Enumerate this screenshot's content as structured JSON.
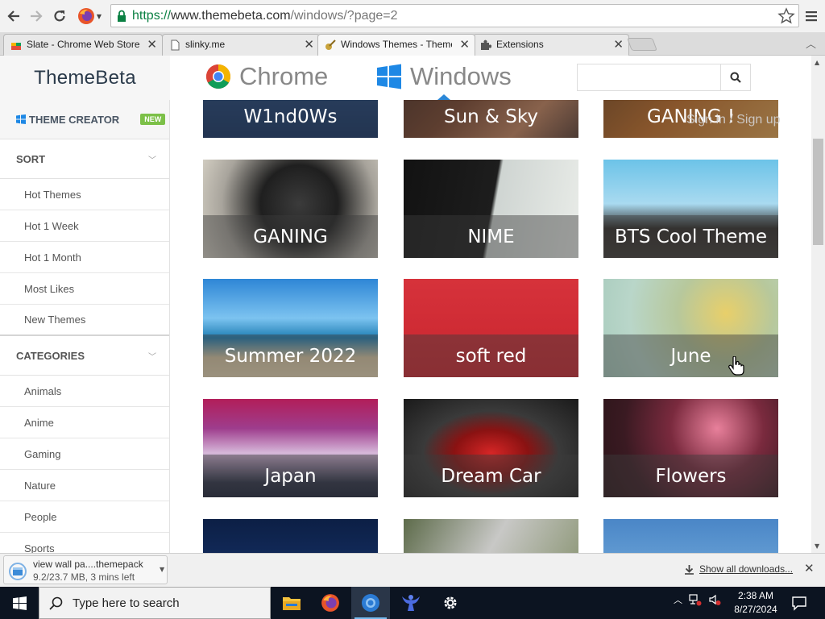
{
  "browser": {
    "url": {
      "scheme": "https://",
      "host": "www.themebeta.com",
      "path": "/windows/?page=2"
    },
    "tabs": [
      {
        "title": "Slate - Chrome Web Store",
        "active": false
      },
      {
        "title": "slinky.me",
        "active": false
      },
      {
        "title": "Windows Themes - Theme",
        "active": true
      },
      {
        "title": "Extensions",
        "active": false
      }
    ],
    "close_glyph": "✕",
    "accent_green": "#0b8043"
  },
  "site": {
    "logo": "ThemeBeta",
    "nav": [
      {
        "label": "Chrome",
        "icon": "chrome-icon"
      },
      {
        "label": "Windows",
        "icon": "windows-logo-icon"
      }
    ],
    "search_placeholder": "",
    "signin_text": "Sign in / Sign up",
    "brand_blue": "#2b88d8"
  },
  "sidebar": {
    "theme_creator": {
      "label": "THEME CREATOR",
      "badge": "NEW"
    },
    "sort": {
      "heading": "SORT",
      "items": [
        "Hot Themes",
        "Hot 1 Week",
        "Hot 1 Month",
        "Most Likes",
        "New Themes"
      ]
    },
    "categories": {
      "heading": "CATEGORIES",
      "items": [
        "Animals",
        "Anime",
        "Gaming",
        "Nature",
        "People",
        "Sports"
      ]
    }
  },
  "themes": [
    {
      "title": "W1nd0Ws",
      "palette": "night-blue"
    },
    {
      "title": "Sun & Sky",
      "palette": "dusk-brown"
    },
    {
      "title": "GANING !",
      "palette": "amber"
    },
    {
      "title": "GANING",
      "palette": "dark-knight"
    },
    {
      "title": "NIME",
      "palette": "ink-white"
    },
    {
      "title": "BTS Cool Theme",
      "palette": "sky-cliff"
    },
    {
      "title": "Summer 2022",
      "palette": "beach"
    },
    {
      "title": "soft red",
      "palette": "red"
    },
    {
      "title": "June",
      "palette": "floral-green"
    },
    {
      "title": "Japan",
      "palette": "sakura-fuji"
    },
    {
      "title": "Dream Car",
      "palette": "red-car"
    },
    {
      "title": "Flowers",
      "palette": "pink-blossom"
    },
    {
      "title": "",
      "palette": "night-sky"
    },
    {
      "title": "",
      "palette": "forest-grey"
    },
    {
      "title": "",
      "palette": "treetop-blue"
    }
  ],
  "downloads": {
    "filename": "view wall pa....themepack",
    "status": "9.2/23.7 MB, 3 mins left",
    "show_all": "Show all downloads..."
  },
  "taskbar": {
    "search_placeholder": "Type here to search",
    "apps": [
      "file-explorer-icon",
      "firefox-icon",
      "chrome-icon",
      "genie-app-icon",
      "settings-gear-icon"
    ],
    "time": "2:38 AM",
    "date": "8/27/2024"
  }
}
